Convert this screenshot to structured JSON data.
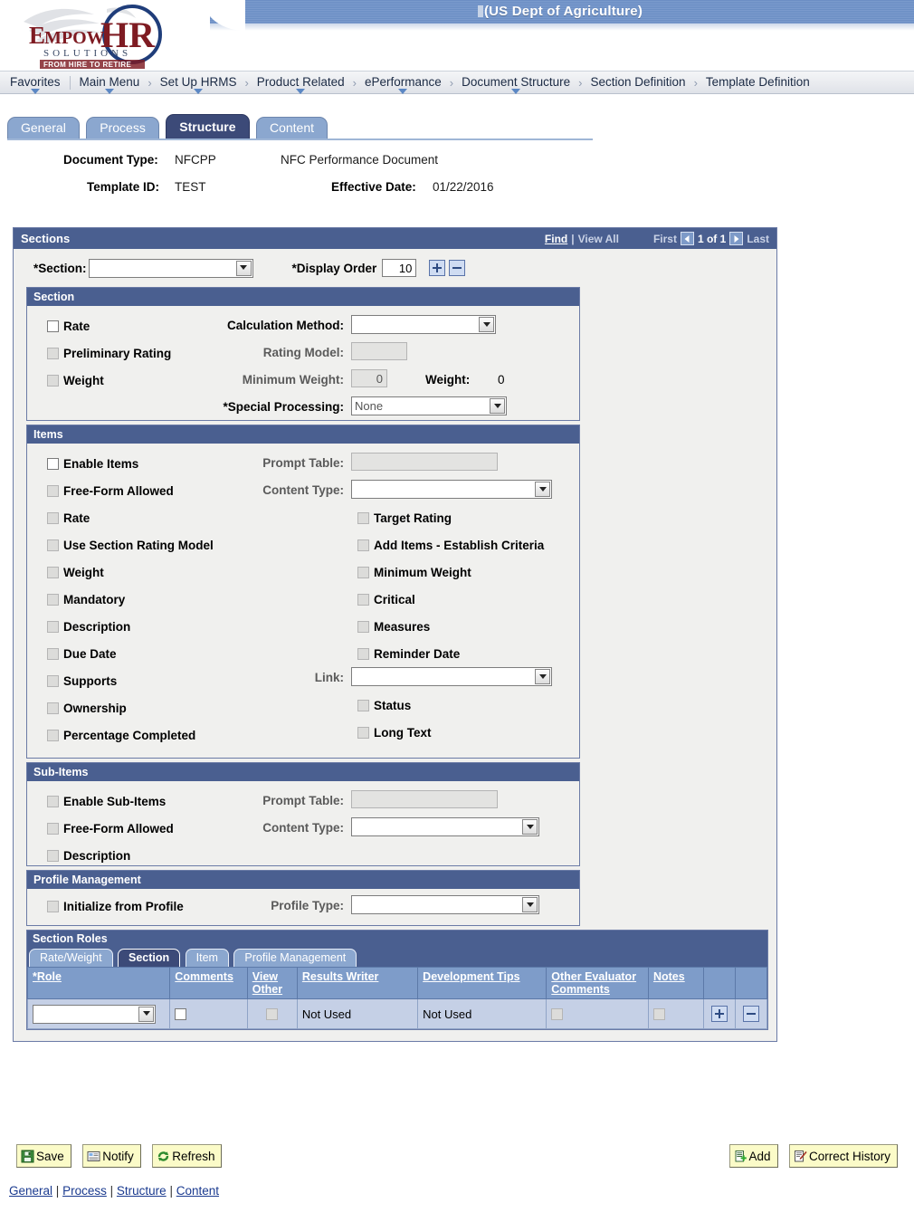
{
  "header": {
    "title_redacted_prefix": "",
    "title": "(US Dept of Agriculture)",
    "logo": {
      "word_empow": "Empow",
      "word_hr": "HR",
      "solutions": "SOLUTIONS",
      "tagline": "FROM HIRE TO RETIRE"
    }
  },
  "breadcrumb": {
    "favorites": "Favorites",
    "items": [
      {
        "label": "Main Menu",
        "has_dropdown": true
      },
      {
        "label": "Set Up HRMS",
        "has_dropdown": true
      },
      {
        "label": "Product Related",
        "has_dropdown": true
      },
      {
        "label": "ePerformance",
        "has_dropdown": true
      },
      {
        "label": "Document Structure",
        "has_dropdown": true
      },
      {
        "label": "Section Definition",
        "has_dropdown": false
      },
      {
        "label": "Template Definition",
        "has_dropdown": false
      }
    ],
    "separator": "›"
  },
  "tabs": [
    {
      "label": "General",
      "active": false
    },
    {
      "label": "Process",
      "active": false
    },
    {
      "label": "Structure",
      "active": true
    },
    {
      "label": "Content",
      "active": false
    }
  ],
  "doc_info": {
    "document_type_label": "Document Type:",
    "document_type_value": "NFCPP",
    "document_type_desc": "NFC Performance Document",
    "template_id_label": "Template ID:",
    "template_id_value": "TEST",
    "effective_date_label": "Effective Date:",
    "effective_date_value": "01/22/2016"
  },
  "sections_grid": {
    "title": "Sections",
    "find": "Find",
    "pipe": "|",
    "view_all": "View All",
    "first": "First",
    "counter": "1 of 1",
    "last": "Last",
    "section_label": "*Section:",
    "section_value": "",
    "display_order_label": "*Display Order",
    "display_order_value": "10",
    "add_button": "+",
    "remove_button": "−"
  },
  "section_panel": {
    "title": "Section",
    "checkboxes": [
      {
        "label": "Rate",
        "checked": false,
        "disabled": false
      },
      {
        "label": "Preliminary Rating",
        "checked": false,
        "disabled": true
      },
      {
        "label": "Weight",
        "checked": false,
        "disabled": true
      }
    ],
    "calculation_method_label": "Calculation Method:",
    "calculation_method_value": "",
    "rating_model_label": "Rating Model:",
    "rating_model_value": "",
    "minimum_weight_label": "Minimum Weight:",
    "minimum_weight_value": "0",
    "weight_label": "Weight:",
    "weight_value": "0",
    "special_processing_label": "*Special Processing:",
    "special_processing_value": "None"
  },
  "items_panel": {
    "title": "Items",
    "left_checkboxes": [
      {
        "label": "Enable Items",
        "checked": false,
        "disabled": false
      },
      {
        "label": "Free-Form Allowed",
        "checked": false,
        "disabled": true
      },
      {
        "label": "Rate",
        "checked": false,
        "disabled": true
      },
      {
        "label": "Use Section Rating Model",
        "checked": false,
        "disabled": true
      },
      {
        "label": "Weight",
        "checked": false,
        "disabled": true
      },
      {
        "label": "Mandatory",
        "checked": false,
        "disabled": true
      },
      {
        "label": "Description",
        "checked": false,
        "disabled": true
      },
      {
        "label": "Due Date",
        "checked": false,
        "disabled": true
      },
      {
        "label": "Supports",
        "checked": false,
        "disabled": true
      },
      {
        "label": "Ownership",
        "checked": false,
        "disabled": true
      },
      {
        "label": "Percentage Completed",
        "checked": false,
        "disabled": true
      }
    ],
    "right_checkboxes": [
      {
        "label": "Target Rating",
        "checked": false,
        "disabled": true
      },
      {
        "label": "Add Items - Establish Criteria",
        "checked": false,
        "disabled": true
      },
      {
        "label": "Minimum Weight",
        "checked": false,
        "disabled": true
      },
      {
        "label": "Critical",
        "checked": false,
        "disabled": true
      },
      {
        "label": "Measures",
        "checked": false,
        "disabled": true
      },
      {
        "label": "Reminder Date",
        "checked": false,
        "disabled": true
      }
    ],
    "tail_checkboxes": [
      {
        "label": "Status",
        "checked": false,
        "disabled": true
      },
      {
        "label": "Long Text",
        "checked": false,
        "disabled": true
      }
    ],
    "prompt_table_label": "Prompt Table:",
    "prompt_table_value": "",
    "content_type_label": "Content Type:",
    "content_type_value": "",
    "link_label": "Link:",
    "link_value": ""
  },
  "subitems_panel": {
    "title": "Sub-Items",
    "checkboxes": [
      {
        "label": "Enable Sub-Items",
        "checked": false,
        "disabled": true
      },
      {
        "label": "Free-Form Allowed",
        "checked": false,
        "disabled": true
      },
      {
        "label": "Description",
        "checked": false,
        "disabled": true
      }
    ],
    "prompt_table_label": "Prompt Table:",
    "prompt_table_value": "",
    "content_type_label": "Content Type:",
    "content_type_value": ""
  },
  "profile_panel": {
    "title": "Profile Management",
    "checkbox_label": "Initialize from Profile",
    "profile_type_label": "Profile Type:",
    "profile_type_value": ""
  },
  "section_roles": {
    "title": "Section Roles",
    "subtabs": [
      {
        "label": "Rate/Weight",
        "active": false
      },
      {
        "label": "Section",
        "active": true
      },
      {
        "label": "Item",
        "active": false
      },
      {
        "label": "Profile Management",
        "active": false
      }
    ],
    "columns": [
      {
        "label": "*Role",
        "underline": true
      },
      {
        "label": "Comments",
        "underline": true
      },
      {
        "label": "View Other",
        "underline": true
      },
      {
        "label": "Results Writer",
        "underline": true
      },
      {
        "label": "Development Tips",
        "underline": true
      },
      {
        "label": "Other Evaluator Comments",
        "underline": true
      },
      {
        "label": "Notes",
        "underline": true
      },
      {
        "label": "",
        "underline": false
      },
      {
        "label": "",
        "underline": false
      }
    ],
    "row": {
      "role_value": "",
      "comments_checked": false,
      "comments_disabled": false,
      "view_other_checked": false,
      "view_other_disabled": true,
      "results_writer": "Not Used",
      "development_tips": "Not Used",
      "other_evaluator_checked": false,
      "other_evaluator_disabled": true,
      "notes_checked": false,
      "notes_disabled": true,
      "add_button": "+",
      "remove_button": "−"
    }
  },
  "action_buttons": {
    "left": [
      {
        "label": "Save",
        "icon": "save-disk-icon"
      },
      {
        "label": "Notify",
        "icon": "envelope-icon"
      },
      {
        "label": "Refresh",
        "icon": "refresh-arrows-icon"
      }
    ],
    "right": [
      {
        "label": "Add",
        "icon": "add-document-icon"
      },
      {
        "label": "Correct History",
        "icon": "pencil-document-icon"
      }
    ]
  },
  "footer_links": [
    {
      "label": "General"
    },
    {
      "label": "Process"
    },
    {
      "label": "Structure"
    },
    {
      "label": "Content"
    }
  ],
  "footer_separator": "|",
  "colors": {
    "panel_header": "#4a5f90",
    "active_tab": "#3c4a78",
    "inactive_tab": "#8ba7cf",
    "grid_header": "#7e9cc9",
    "grid_row": "#c5d0e6",
    "button_face": "#fbfbc8",
    "page_bg": "#f0f0ee",
    "link": "#1a3a8f"
  }
}
